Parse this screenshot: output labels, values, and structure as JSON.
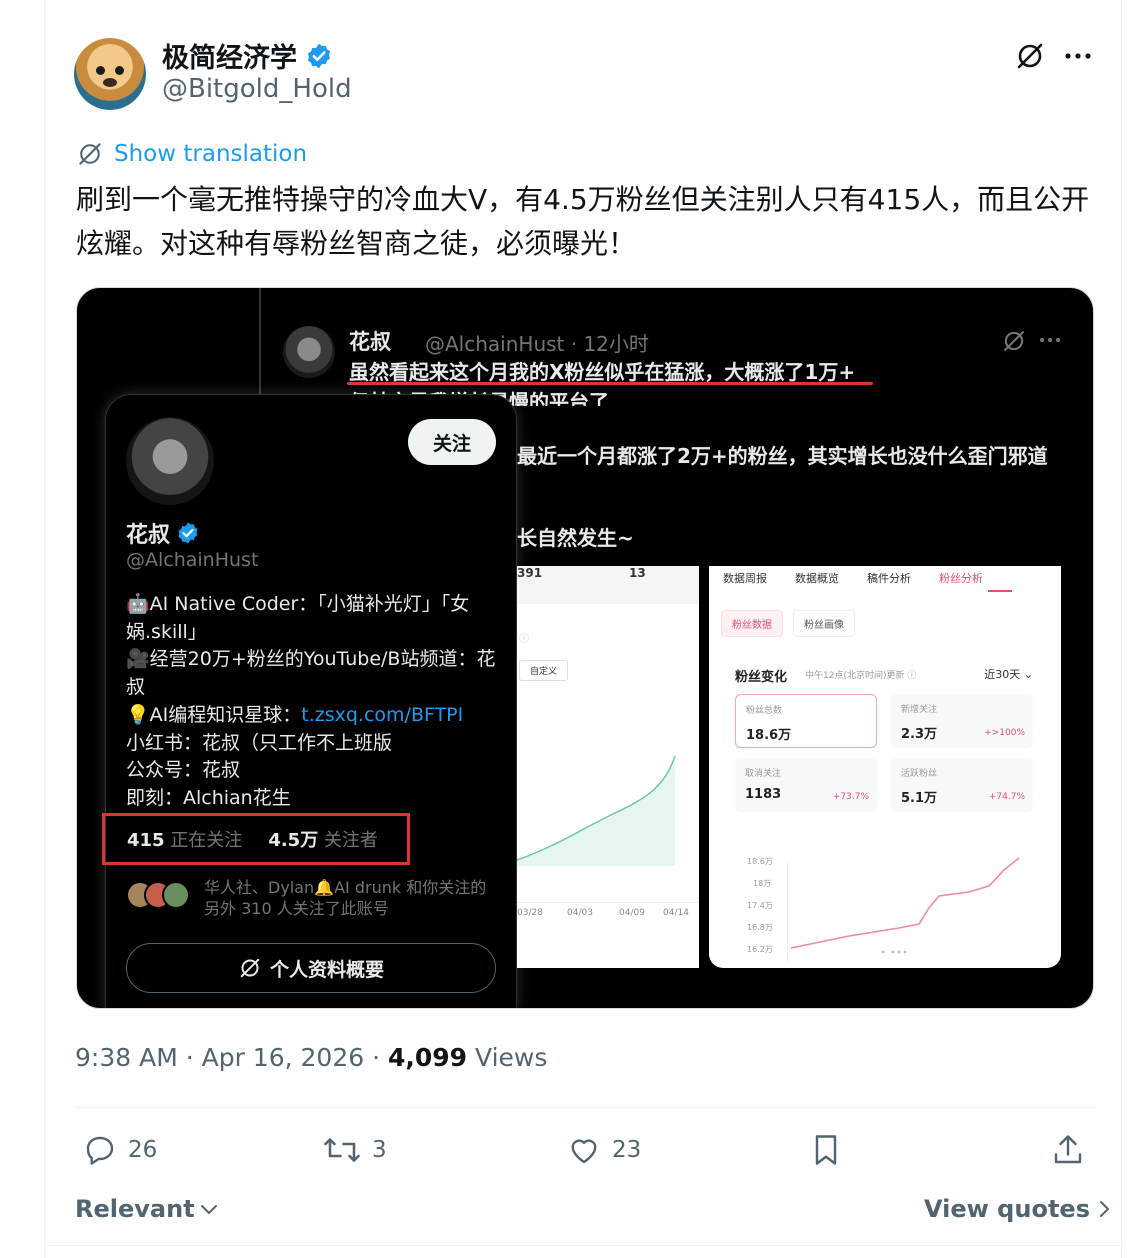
{
  "author": {
    "display_name": "极简经济学",
    "handle": "@Bitgold_Hold",
    "avatar_icon": "dog-avatar",
    "verified_icon": "verified-badge-icon"
  },
  "header": {
    "grok_icon": "grok-icon",
    "more_icon": "more-icon"
  },
  "translation": {
    "label": "Show translation"
  },
  "tweet": {
    "text": "刷到一个毫无推特操守的冷血大V，有4.5万粉丝但关注别人只有415人，而且公开炫耀。对这种有辱粉丝智商之徒，必须曝光！"
  },
  "media": {
    "post": {
      "name": "花叔",
      "handle_time": "@AlchainHust · 12小时",
      "line1": "虽然看起来这个月我的X粉丝似乎在猛涨，大概涨了1万+",
      "line2": "但其实是我增长最慢的平台了",
      "line3": "最近一个月都涨了2万+的粉丝，其实增长也没什么歪门邪道",
      "line4": "长自然发生~"
    },
    "card": {
      "follow_label": "关注",
      "name": "花叔",
      "handle": "@AlchainHust",
      "bio": [
        {
          "text": "🤖AI Native Coder：「小猫补光灯」「女娲.skill」"
        },
        {
          "text": "🎥经营20万+粉丝的YouTube/B站频道：花叔"
        },
        {
          "text": "💡AI编程知识星球：",
          "link": "t.zsxq.com/BFTPI"
        },
        {
          "text": "小红书：花叔（只工作不上班版"
        },
        {
          "text": "公众号：花叔"
        },
        {
          "text": "即刻：Alchian花生"
        }
      ],
      "following_count": "415",
      "following_label": "正在关注",
      "followers_count": "4.5万",
      "followers_label": "关注者",
      "mutual_text": "华人社、Dylan🔔AI drunk 和你关注的另外 310 人关注了此账号",
      "profile_button": "个人资料概要"
    },
    "left_panel": {
      "top_values": [
        "391",
        "13"
      ],
      "custom_label": "自定义",
      "x_ticks": [
        "03/28",
        "04/03",
        "04/09",
        "04/14"
      ]
    },
    "right_panel": {
      "tabs": [
        "数据周报",
        "数据概览",
        "稿件分析",
        "粉丝分析"
      ],
      "active_tab": "粉丝分析",
      "sub_tabs": [
        "粉丝数据",
        "粉丝画像"
      ],
      "title": "粉丝变化",
      "note": "中午12点(北京时间)更新 ⓘ",
      "range": "近30天 ⌄",
      "kpis": [
        {
          "label": "粉丝总数",
          "value": "18.6万",
          "change": ""
        },
        {
          "label": "新增关注",
          "value": "2.3万",
          "change": "+>100%"
        },
        {
          "label": "取消关注",
          "value": "1183",
          "change": "+73.7%"
        },
        {
          "label": "活跃粉丝",
          "value": "5.1万",
          "change": "+74.7%"
        }
      ],
      "y_ticks": [
        "18.6万",
        "18万",
        "17.4万",
        "16.8万",
        "16.2万"
      ]
    },
    "accent_red": "#e0342f",
    "accent_pink": "#e94c6f"
  },
  "meta": {
    "time": "9:38 AM",
    "date": "Apr 16, 2026",
    "views_count": "4,099",
    "views_label": "Views"
  },
  "actions": {
    "replies": "26",
    "reposts": "3",
    "likes": "23"
  },
  "footer": {
    "sort_label": "Relevant",
    "view_quotes_label": "View quotes"
  },
  "colors": {
    "link_blue": "#1d9bf0",
    "secondary_text": "#536471"
  }
}
